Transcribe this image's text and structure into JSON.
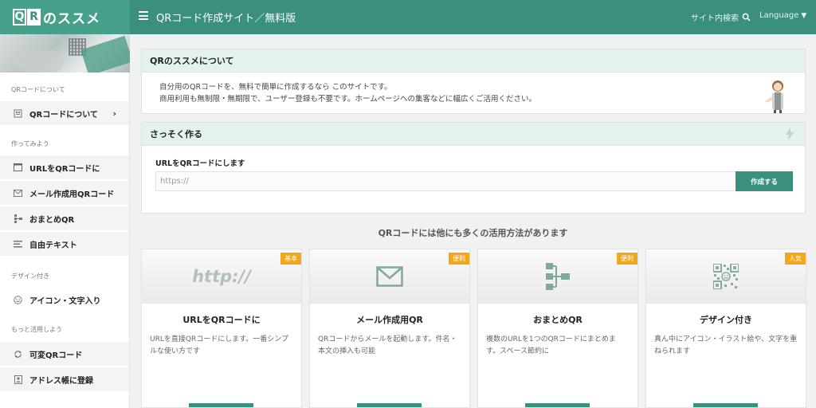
{
  "header": {
    "logo_q": "Q",
    "logo_r": "R",
    "logo_text": "のススメ",
    "site_title": "QRコード作成サイト／無料版",
    "search_label": "サイト内検索",
    "language_label": "Language",
    "language_caret": "▼"
  },
  "sidebar": {
    "sections": [
      "QRコードについて",
      "作ってみよう",
      "デザイン付き",
      "もっと活用しよう"
    ],
    "items": [
      {
        "label": "QRコードについて",
        "icon": "qr-doc-icon",
        "chevron": "›"
      },
      {
        "label": "URLをQRコードに",
        "icon": "window-icon"
      },
      {
        "label": "メール作成用QRコード",
        "icon": "mail-icon"
      },
      {
        "label": "おまとめQR",
        "icon": "sitemap-icon"
      },
      {
        "label": "自由テキスト",
        "icon": "text-lines-icon"
      },
      {
        "label": "アイコン・文字入り",
        "icon": "smile-icon"
      },
      {
        "label": "可変QRコード",
        "icon": "refresh-icon"
      },
      {
        "label": "アドレス帳に登録",
        "icon": "contact-book-icon"
      }
    ]
  },
  "about": {
    "heading": "QRのススメについて",
    "line1": "自分用のQRコードを、無料で簡単に作成するなら このサイトです。",
    "line2": "商用利用も無制限・無期限で、ユーザー登録も不要です。ホームページへの集客などに幅広くご活用ください。"
  },
  "create": {
    "heading": "さっそく作る",
    "label": "URLをQRコードにします",
    "placeholder": "https://",
    "button": "作成する"
  },
  "more_heading": "QRコードには他にも多くの活用方法があります",
  "cards": [
    {
      "badge": "基本",
      "visual": "http://",
      "title": "URLをQRコードに",
      "desc": "URLを直接QRコードにします。一番シンプルな使い方です"
    },
    {
      "badge": "便利",
      "title": "メール作成用QR",
      "desc": "QRコードからメールを起動します。件名・本文の挿入も可能"
    },
    {
      "badge": "便利",
      "title": "おまとめQR",
      "desc": "複数のURLを1つのQRコードにまとめます。スペース節約に"
    },
    {
      "badge": "人気",
      "title": "デザイン付き",
      "desc": "真ん中にアイコン・イラスト絵や、文字を重ねられます"
    }
  ],
  "colors": {
    "brand": "#3a8f7d",
    "badge": "#f2a81a",
    "panel_head": "#e4f2ee"
  }
}
